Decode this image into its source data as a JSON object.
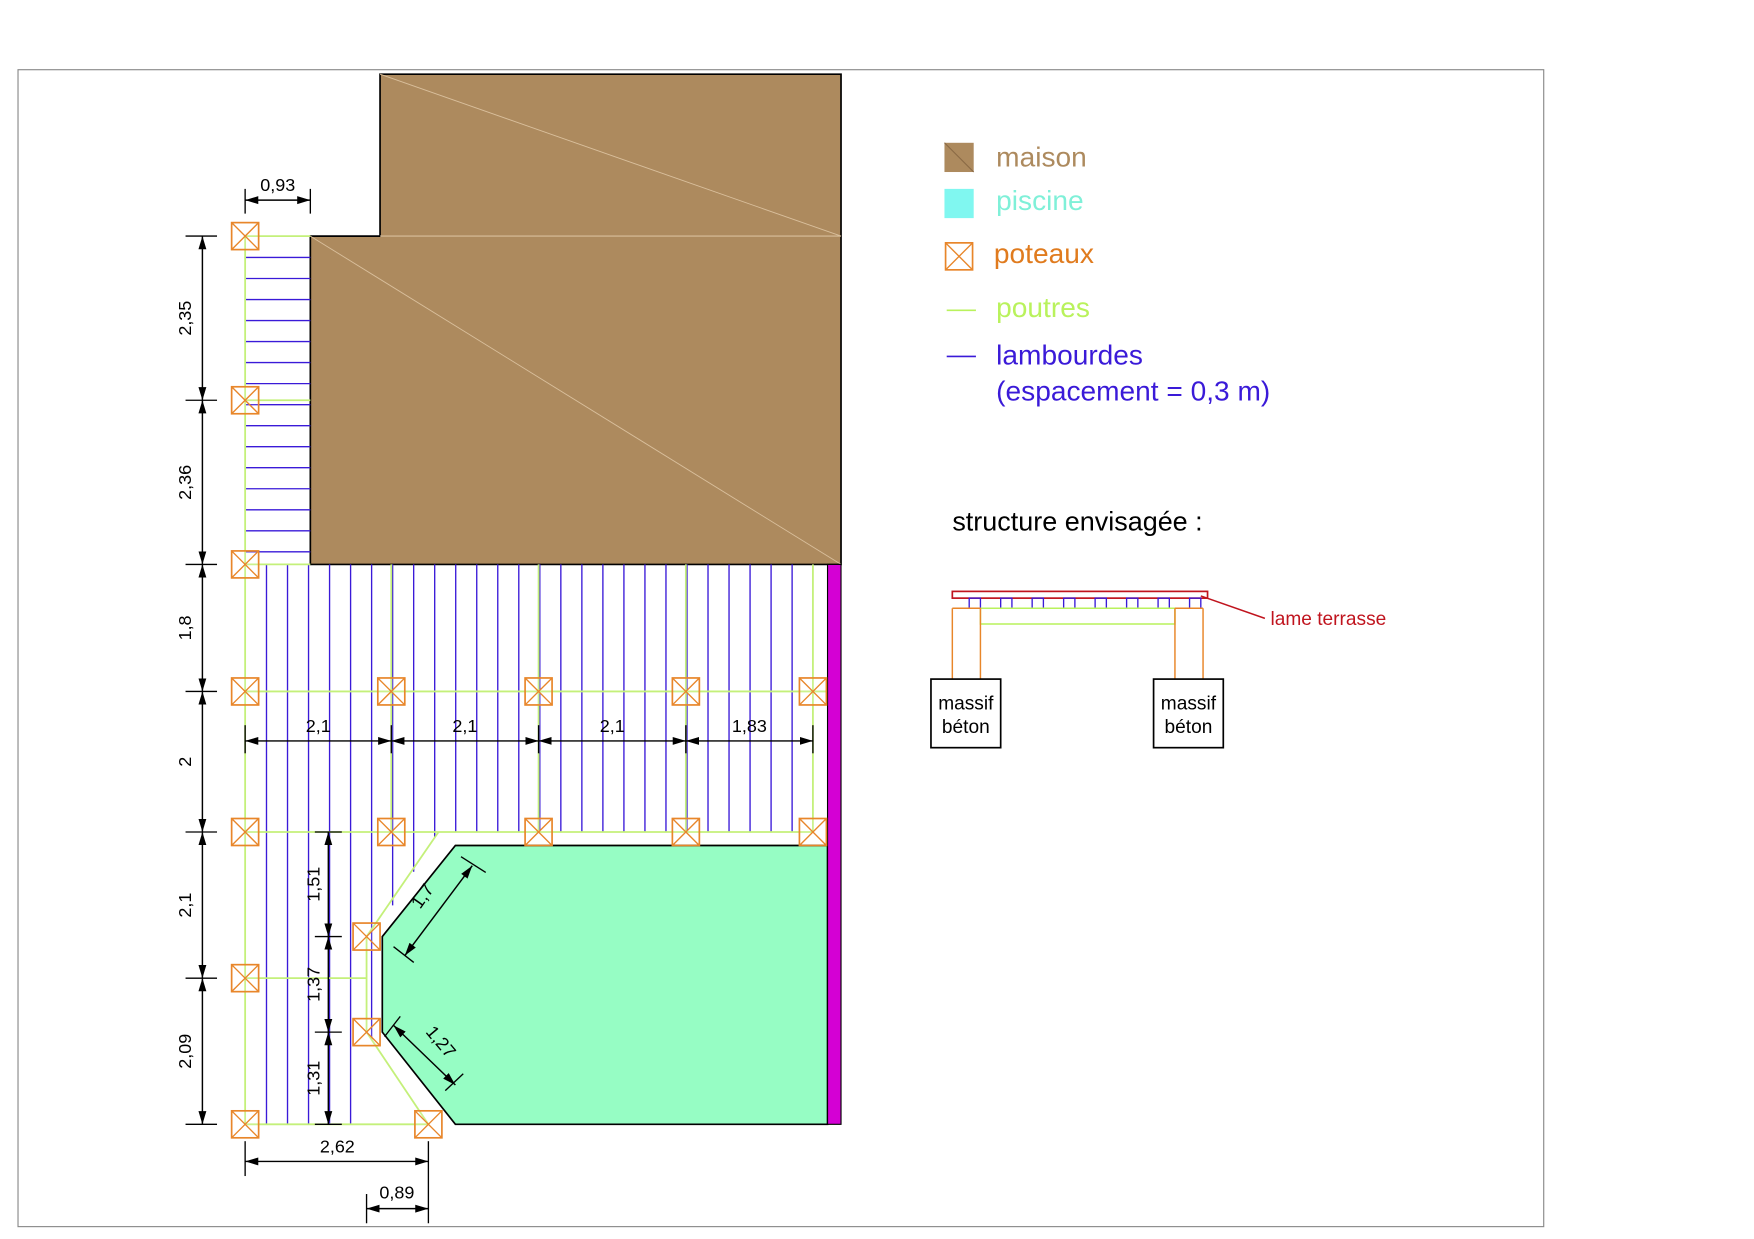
{
  "legend": {
    "items": [
      {
        "label": "maison",
        "color": "#ad8a5e",
        "icon": "house-swatch-icon"
      },
      {
        "label": "piscine",
        "color": "#96fdc4",
        "icon": "pool-swatch-icon"
      },
      {
        "label": "poteaux",
        "color": "#e8862a",
        "icon": "post-icon"
      },
      {
        "label": "poutres",
        "color": "#b9f25c",
        "icon": "beam-line-icon"
      },
      {
        "label": "lambourdes",
        "color": "#3a1ad8",
        "icon": "joist-line-icon"
      }
    ],
    "joist_note": "(espacement = 0,3 m)",
    "piscine_label_color": "#7ff0d8",
    "poteaux_label_color": "#e07b1e"
  },
  "structure": {
    "title": "structure envisagée :",
    "deck_label": "lame terrasse",
    "footing_label_line1": "massif",
    "footing_label_line2": "béton"
  },
  "dimensions": {
    "top_width": "0,93",
    "left": [
      "2,35",
      "2,36",
      "1,8",
      "2",
      "2,1",
      "2,09"
    ],
    "spans": [
      "2,1",
      "2,1",
      "2,1",
      "1,83"
    ],
    "inner": [
      "1,51",
      "1,37",
      "1,31"
    ],
    "diag_upper": "1,7",
    "diag_lower": "1,27",
    "bottom_width": "2,62",
    "bottom_offset": "0,89"
  },
  "colors": {
    "house": "#ad8a5e",
    "pool": "#96fdc4",
    "edge": "#d400d4",
    "post": "#e8862a",
    "beam": "#c4f07a",
    "joist": "#3a1ad8",
    "deck": "#c0141e"
  }
}
